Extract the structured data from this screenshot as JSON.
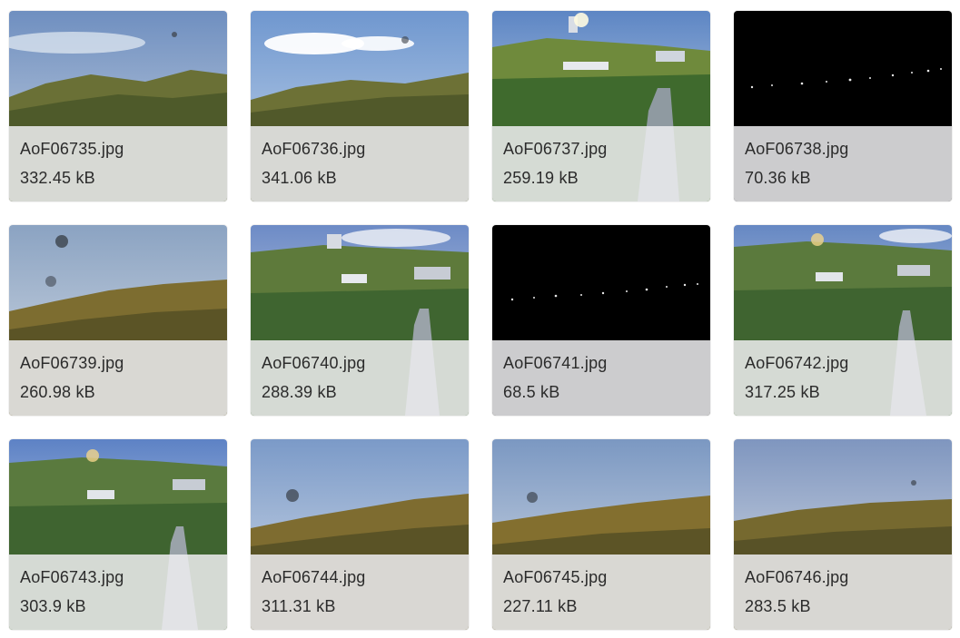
{
  "gallery": {
    "items": [
      {
        "filename": "AoF06735.jpg",
        "size": "332.45 kB",
        "scene": "hills-cloudy-sky"
      },
      {
        "filename": "AoF06736.jpg",
        "size": "341.06 kB",
        "scene": "hills-cloud"
      },
      {
        "filename": "AoF06737.jpg",
        "size": "259.19 kB",
        "scene": "city-valley-sunny"
      },
      {
        "filename": "AoF06738.jpg",
        "size": "70.36 kB",
        "scene": "night-lights"
      },
      {
        "filename": "AoF06739.jpg",
        "size": "260.98 kB",
        "scene": "hills-spotted-lens"
      },
      {
        "filename": "AoF06740.jpg",
        "size": "288.39 kB",
        "scene": "city-valley-cloudy"
      },
      {
        "filename": "AoF06741.jpg",
        "size": "68.5 kB",
        "scene": "night-lights"
      },
      {
        "filename": "AoF06742.jpg",
        "size": "317.25 kB",
        "scene": "city-valley-flare"
      },
      {
        "filename": "AoF06743.jpg",
        "size": "303.9 kB",
        "scene": "city-valley-flare"
      },
      {
        "filename": "AoF06744.jpg",
        "size": "311.31 kB",
        "scene": "hills-spotted-lens"
      },
      {
        "filename": "AoF06745.jpg",
        "size": "227.11 kB",
        "scene": "hills-spotted-lens"
      },
      {
        "filename": "AoF06746.jpg",
        "size": "283.5 kB",
        "scene": "hills-hazy"
      }
    ]
  }
}
